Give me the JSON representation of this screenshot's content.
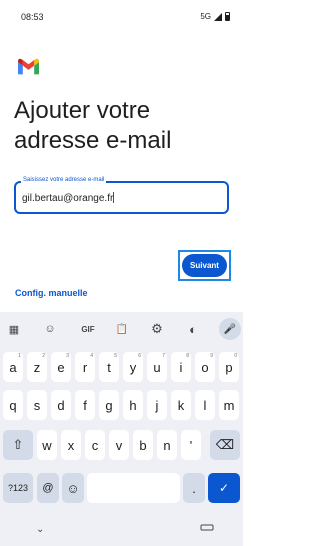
{
  "status_bar": {
    "time": "08:53",
    "network": "5G"
  },
  "page": {
    "title": "Ajouter votre adresse e-mail",
    "email_label": "Saisissez votre adresse e-mail",
    "email_value": "gil.bertau@orange.fr",
    "manual_link": "Config. manuelle",
    "next_button": "Suivant"
  },
  "keyboard": {
    "toolbar": [
      {
        "name": "apps-grid-icon",
        "glyph": "▦"
      },
      {
        "name": "sticker-icon",
        "glyph": "☺"
      },
      {
        "name": "gif-button",
        "glyph": "GIF"
      },
      {
        "name": "clipboard-icon",
        "glyph": "📋"
      },
      {
        "name": "settings-gear-icon",
        "glyph": "⚙"
      },
      {
        "name": "palette-icon",
        "glyph": "◐"
      },
      {
        "name": "microphone-icon",
        "glyph": "🎤"
      }
    ],
    "row1": [
      {
        "key": "a",
        "hint": "1"
      },
      {
        "key": "z",
        "hint": "2"
      },
      {
        "key": "e",
        "hint": "3"
      },
      {
        "key": "r",
        "hint": "4"
      },
      {
        "key": "t",
        "hint": "5"
      },
      {
        "key": "y",
        "hint": "6"
      },
      {
        "key": "u",
        "hint": "7"
      },
      {
        "key": "i",
        "hint": "8"
      },
      {
        "key": "o",
        "hint": "9"
      },
      {
        "key": "p",
        "hint": "0"
      }
    ],
    "row2": [
      "q",
      "s",
      "d",
      "f",
      "g",
      "h",
      "j",
      "k",
      "l",
      "m"
    ],
    "row3": [
      "w",
      "x",
      "c",
      "v",
      "b",
      "n",
      "'"
    ],
    "row4": {
      "symbols": "?123",
      "at": "@",
      "dot": "."
    },
    "shift_icon": "⇧",
    "backspace_icon": "⌫",
    "emoji_icon": "☺",
    "enter_icon": "✓",
    "nav_chevron": "⌄"
  },
  "colors": {
    "accent": "#0b57d0",
    "keyboard_bg": "#eef0f5",
    "func_key": "#d3dbe9"
  }
}
